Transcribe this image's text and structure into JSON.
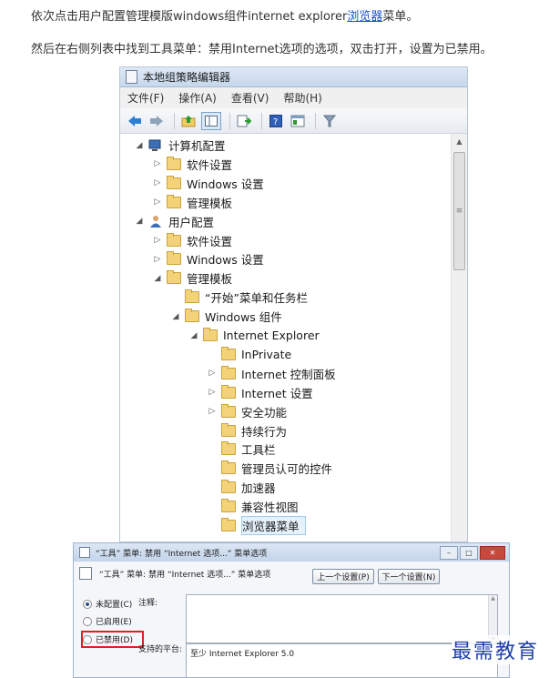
{
  "article": {
    "line1_before": "依次点击用户配置管理模版windows组件internet explorer",
    "line1_link": "浏览器",
    "line1_after": "菜单。",
    "line2": "然后在右侧列表中找到工具菜单：禁用Internet选项的选项，双击打开，设置为已禁用。"
  },
  "gpe": {
    "title": "本地组策略编辑器",
    "menu": [
      "文件(F)",
      "操作(A)",
      "查看(V)",
      "帮助(H)"
    ],
    "tree": [
      {
        "label": "计算机配置",
        "toggle": "◢",
        "icon": "computer"
      },
      {
        "label": "软件设置",
        "toggle": "▷",
        "icon": "folder"
      },
      {
        "label": "Windows 设置",
        "toggle": "▷",
        "icon": "folder"
      },
      {
        "label": "管理模板",
        "toggle": "▷",
        "icon": "folder"
      },
      {
        "label": "用户配置",
        "toggle": "◢",
        "icon": "user"
      },
      {
        "label": "软件设置",
        "toggle": "▷",
        "icon": "folder"
      },
      {
        "label": "Windows 设置",
        "toggle": "▷",
        "icon": "folder"
      },
      {
        "label": "管理模板",
        "toggle": "◢",
        "icon": "folder"
      },
      {
        "label": "“开始”菜单和任务栏",
        "toggle": "",
        "icon": "folder"
      },
      {
        "label": "Windows 组件",
        "toggle": "◢",
        "icon": "folder"
      },
      {
        "label": "Internet Explorer",
        "toggle": "◢",
        "icon": "folder"
      },
      {
        "label": "InPrivate",
        "toggle": "",
        "icon": "folder"
      },
      {
        "label": "Internet 控制面板",
        "toggle": "▷",
        "icon": "folder"
      },
      {
        "label": "Internet 设置",
        "toggle": "▷",
        "icon": "folder"
      },
      {
        "label": "安全功能",
        "toggle": "▷",
        "icon": "folder"
      },
      {
        "label": "持续行为",
        "toggle": "",
        "icon": "folder"
      },
      {
        "label": "工具栏",
        "toggle": "",
        "icon": "folder"
      },
      {
        "label": "管理员认可的控件",
        "toggle": "",
        "icon": "folder"
      },
      {
        "label": "加速器",
        "toggle": "",
        "icon": "folder"
      },
      {
        "label": "兼容性视图",
        "toggle": "",
        "icon": "folder"
      },
      {
        "label": "浏览器菜单",
        "toggle": "",
        "icon": "folder",
        "selected": true
      }
    ]
  },
  "dialog": {
    "title": "“工具” 菜单: 禁用 “Internet 选项...” 菜单选项",
    "heading": "“工具” 菜单: 禁用 “Internet 选项...” 菜单选项",
    "prev_button": "上一个设置(P)",
    "next_button": "下一个设置(N)",
    "radio_not_configured": "未配置(C)",
    "radio_enabled": "已启用(E)",
    "radio_disabled": "已禁用(D)",
    "comment_label": "注释:",
    "platform_label": "支持的平台:",
    "platform_value": "至少 Internet Explorer 5.0",
    "selected_option": "未配置(C)"
  },
  "watermark": "最需教育"
}
